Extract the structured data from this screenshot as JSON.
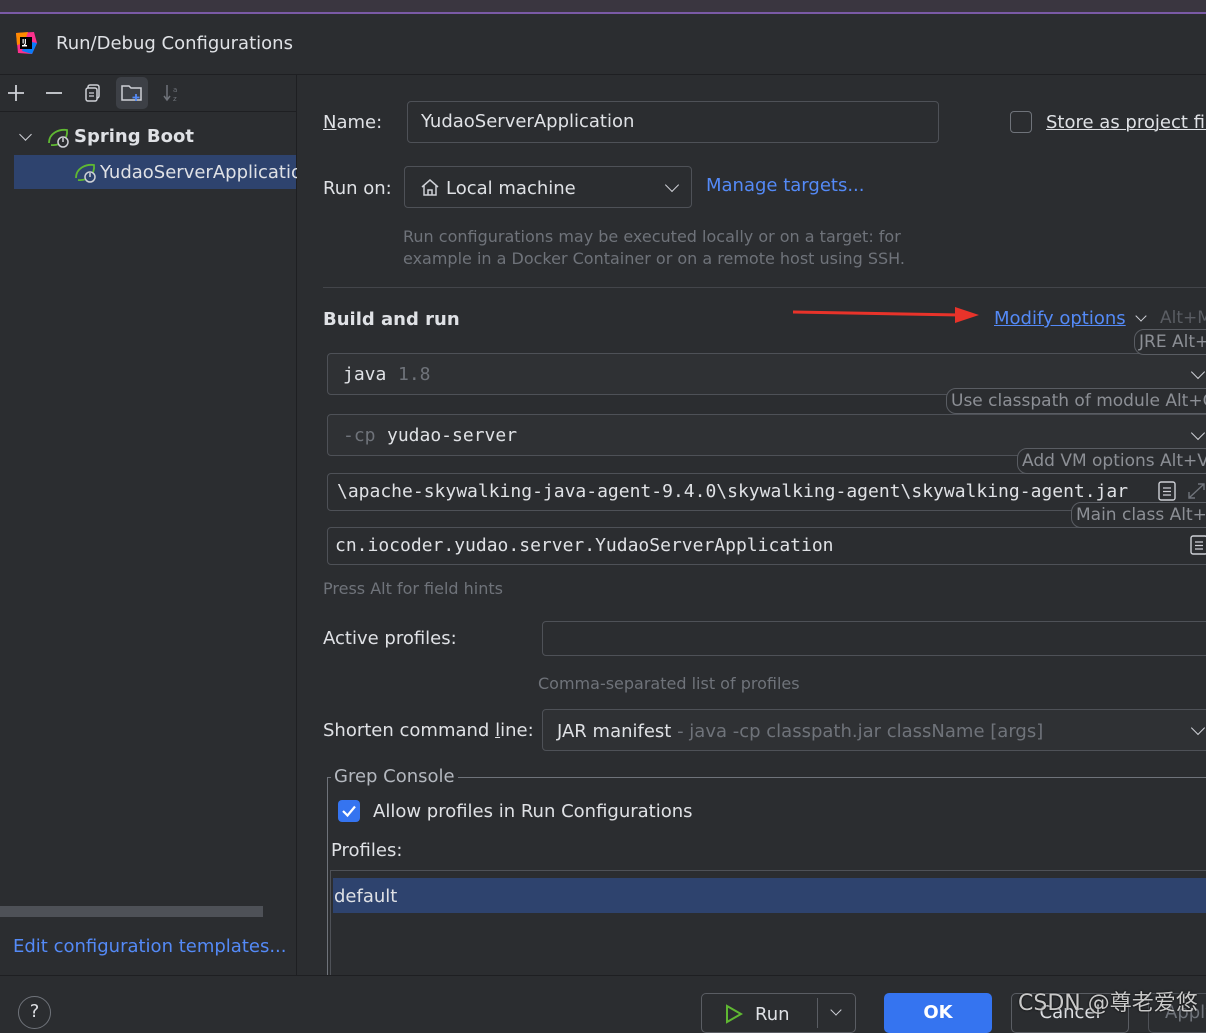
{
  "window": {
    "title": "Run/Debug Configurations"
  },
  "toolbar": {
    "icons": [
      "add-icon",
      "remove-icon",
      "copy-icon",
      "new-folder-icon",
      "sort-icon"
    ]
  },
  "tree": {
    "group_label": "Spring Boot",
    "item_label": "YudaoServerApplicatio"
  },
  "sidebar_footer": {
    "edit_templates": "Edit configuration templates..."
  },
  "form": {
    "name_label": "Name:",
    "name_value": "YudaoServerApplication",
    "store_label": "Store as project file",
    "run_on_label": "Run on:",
    "run_on_value": "Local machine",
    "manage_targets": "Manage targets...",
    "run_on_help_1": "Run configurations may be executed locally or on a target: for",
    "run_on_help_2": "example in a Docker Container or on a remote host using SSH."
  },
  "build_and_run": {
    "section_title": "Build and run",
    "modify_options": "Modify options",
    "modify_shortcut": "Alt+M",
    "jre_prefix": "java",
    "jre_version": "1.8",
    "cp_prefix": "-cp",
    "cp_module": "yudao-server",
    "vm_options": "\\apache-skywalking-java-agent-9.4.0\\skywalking-agent\\skywalking-agent.jar",
    "main_class": "cn.iocoder.yudao.server.YudaoServerApplication",
    "field_hint": "Press Alt for field hints",
    "hints": {
      "jre": "JRE Alt+J",
      "classpath": "Use classpath of module Alt+O",
      "vm": "Add VM options Alt+V",
      "main": "Main class Alt+C"
    }
  },
  "profiles": {
    "active_label": "Active profiles:",
    "active_value": "",
    "active_help": "Comma-separated list of profiles",
    "shorten_label": "Shorten command line:",
    "shorten_value": "JAR manifest",
    "shorten_detail": " - java -cp classpath.jar className [args]"
  },
  "grep_console": {
    "title": "Grep Console",
    "allow_label": "Allow profiles in Run Configurations",
    "allow_checked": true,
    "profiles_label": "Profiles:",
    "profiles": [
      "default"
    ]
  },
  "footer": {
    "help": "?",
    "run": "Run",
    "ok": "OK",
    "cancel": "Cancel",
    "apply": "Apply",
    "watermark": "CSDN @尊老爱悠"
  },
  "colors": {
    "accent": "#3574f0",
    "link": "#548af7",
    "selection": "#2e436e",
    "arrow": "#e8332a"
  }
}
